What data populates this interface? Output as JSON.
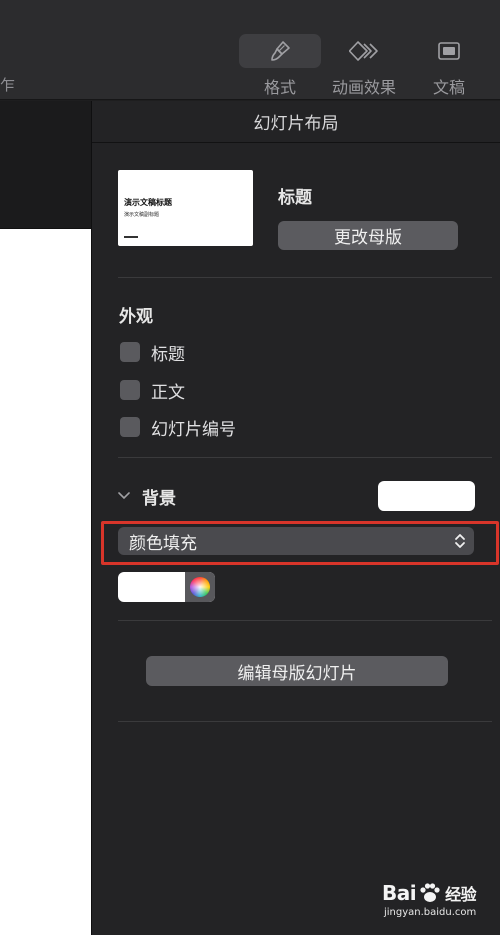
{
  "toolbar": {
    "cut_label": "乍",
    "format_label": "格式",
    "animate_label": "动画效果",
    "document_label": "文稿"
  },
  "inspector": {
    "title": "幻灯片布局",
    "layout": {
      "thumb_title": "演示文稿标题",
      "thumb_subtitle": "演示文稿副标题",
      "name": "标题",
      "change_master_label": "更改母版"
    },
    "appearance": {
      "title": "外观",
      "options": [
        {
          "label": "标题",
          "checked": false
        },
        {
          "label": "正文",
          "checked": false
        },
        {
          "label": "幻灯片编号",
          "checked": false
        }
      ]
    },
    "background": {
      "title": "背景",
      "fill_type": "颜色填充",
      "color": "#ffffff"
    },
    "edit_master_label": "编辑母版幻灯片"
  },
  "watermark": {
    "brand_a": "Bai",
    "brand_b": "经验",
    "url": "jingyan.baidu.com"
  },
  "colors": {
    "accent_highlight": "#d8352a",
    "panel_bg": "#232325",
    "button_bg": "#5b5b5f"
  }
}
